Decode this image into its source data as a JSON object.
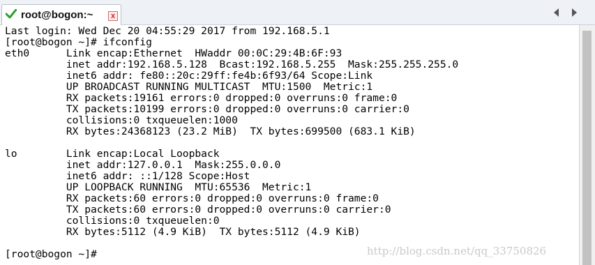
{
  "tab": {
    "title": "root@bogon:~",
    "close_glyph": "x",
    "status_icon": "green-check-icon",
    "status_color": "#2e9e2e"
  },
  "navigation": {
    "prev_icon": "chevron-left-icon",
    "next_icon": "chevron-right-icon"
  },
  "terminal": {
    "lines": [
      "Last login: Wed Dec 20 04:55:29 2017 from 192.168.5.1",
      "[root@bogon ~]# ifconfig",
      "eth0      Link encap:Ethernet  HWaddr 00:0C:29:4B:6F:93",
      "          inet addr:192.168.5.128  Bcast:192.168.5.255  Mask:255.255.255.0",
      "          inet6 addr: fe80::20c:29ff:fe4b:6f93/64 Scope:Link",
      "          UP BROADCAST RUNNING MULTICAST  MTU:1500  Metric:1",
      "          RX packets:19161 errors:0 dropped:0 overruns:0 frame:0",
      "          TX packets:10199 errors:0 dropped:0 overruns:0 carrier:0",
      "          collisions:0 txqueuelen:1000",
      "          RX bytes:24368123 (23.2 MiB)  TX bytes:699500 (683.1 KiB)",
      "",
      "lo        Link encap:Local Loopback",
      "          inet addr:127.0.0.1  Mask:255.0.0.0",
      "          inet6 addr: ::1/128 Scope:Host",
      "          UP LOOPBACK RUNNING  MTU:65536  Metric:1",
      "          RX packets:60 errors:0 dropped:0 overruns:0 frame:0",
      "          TX packets:60 errors:0 dropped:0 overruns:0 carrier:0",
      "          collisions:0 txqueuelen:0",
      "          RX bytes:5112 (4.9 KiB)  TX bytes:5112 (4.9 KiB)",
      "",
      "[root@bogon ~]#"
    ]
  },
  "watermark": "http://blog.csdn.net/qq_33750826"
}
